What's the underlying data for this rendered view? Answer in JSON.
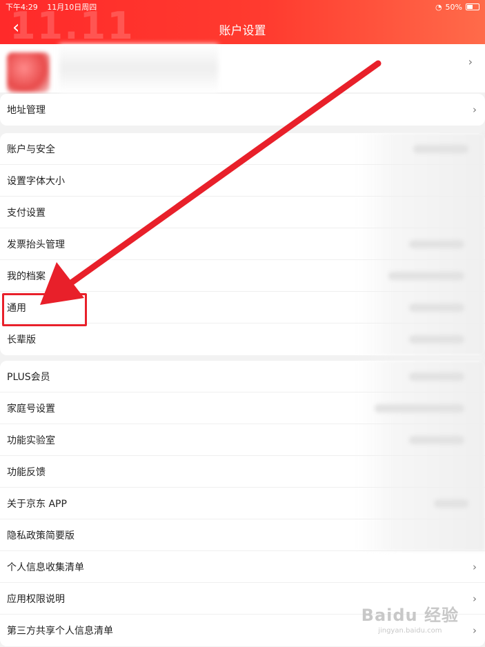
{
  "status_bar": {
    "time": "下午4:29",
    "date": "11月10日周四",
    "battery": "50%"
  },
  "header": {
    "title": "账户设置",
    "back_symbol": "‹",
    "watermark": "11.11"
  },
  "chevron": "›",
  "sections": [
    {
      "items": [
        {
          "label": "地址管理"
        }
      ]
    },
    {
      "items": [
        {
          "label": "账户与安全"
        },
        {
          "label": "设置字体大小"
        },
        {
          "label": "支付设置"
        },
        {
          "label": "发票抬头管理"
        },
        {
          "label": "我的档案"
        },
        {
          "label": "通用"
        },
        {
          "label": "长辈版"
        }
      ]
    },
    {
      "items": [
        {
          "label": "PLUS会员"
        },
        {
          "label": "家庭号设置"
        },
        {
          "label": "功能实验室"
        },
        {
          "label": "功能反馈"
        },
        {
          "label": "关于京东 APP"
        },
        {
          "label": "隐私政策简要版"
        },
        {
          "label": "个人信息收集清单"
        },
        {
          "label": "应用权限说明"
        },
        {
          "label": "第三方共享个人信息清单"
        }
      ]
    }
  ],
  "annotation": {
    "highlight_target": "通用",
    "arrow_color": "#e8202a"
  },
  "watermark": {
    "logo": "Baidu 经验",
    "url": "jingyan.baidu.com"
  },
  "colors": {
    "header_red": "#ff2a2a",
    "background": "#f2f2f2",
    "annotation_red": "#e8202a"
  }
}
